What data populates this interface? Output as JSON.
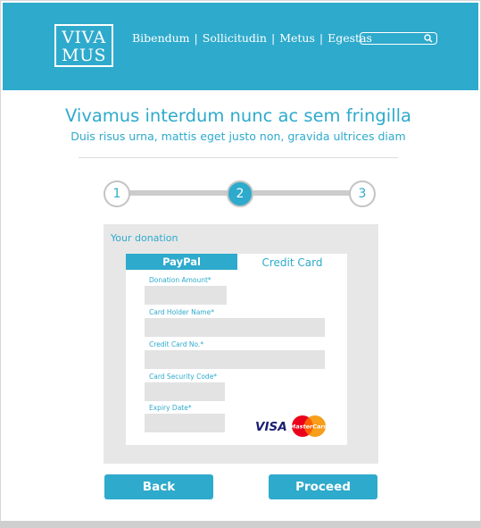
{
  "header": {
    "logo_line1": "VIVA",
    "logo_line2": "MUS",
    "nav": [
      "Bibendum",
      "Sollicitudin",
      "Metus",
      "Egestas"
    ],
    "nav_separator": "|",
    "search_placeholder": ""
  },
  "page": {
    "title": "Vivamus interdum nunc ac sem fringilla",
    "subtitle": "Duis risus urna, mattis eget justo non, gravida ultrices diam"
  },
  "stepper": {
    "steps": [
      "1",
      "2",
      "3"
    ],
    "active_step": 2
  },
  "donation": {
    "panel_title": "Your donation",
    "tabs": {
      "paypal": "PayPal",
      "credit_card": "Credit Card"
    },
    "active_tab": "PayPal",
    "fields": {
      "amount_label": "Donation Amount*",
      "holder_label": "Card Holder Name*",
      "card_no_label": "Credit Card No.*",
      "security_label": "Card Security Code*",
      "expiry_label": "Expiry Date*",
      "amount_value": "",
      "holder_value": "",
      "card_no_value": "",
      "security_value": "",
      "expiry_value": ""
    },
    "brands": {
      "visa": "VISA",
      "mastercard": "MasterCard"
    }
  },
  "buttons": {
    "back": "Back",
    "proceed": "Proceed"
  },
  "colors": {
    "accent": "#2eaacc",
    "panel_bg": "#e7e7e7",
    "field_bg": "#e3e3e3",
    "step_border": "#c4c4c4",
    "visa_blue": "#1a1f71",
    "mastercard_red": "#eb001b",
    "mastercard_orange": "#f79e1b"
  },
  "icons": {
    "search": "search-icon",
    "visa": "visa-logo",
    "mastercard": "mastercard-logo"
  }
}
